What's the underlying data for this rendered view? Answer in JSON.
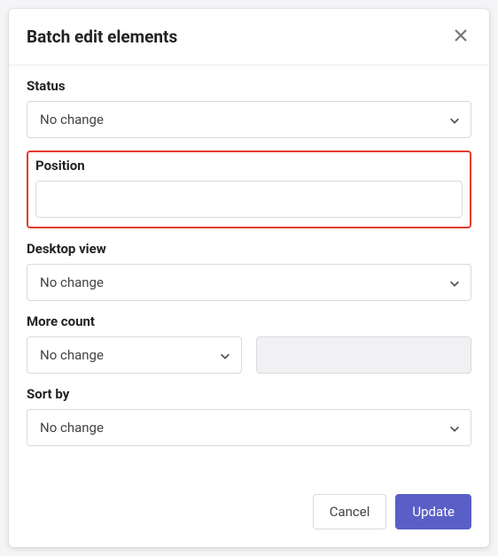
{
  "modal": {
    "title": "Batch edit elements"
  },
  "form": {
    "status": {
      "label": "Status",
      "value": "No change"
    },
    "position": {
      "label": "Position",
      "value": ""
    },
    "desktop_view": {
      "label": "Desktop view",
      "value": "No change"
    },
    "more_count": {
      "label": "More count",
      "value": "No change",
      "extra_value": ""
    },
    "sort_by": {
      "label": "Sort by",
      "value": "No change"
    }
  },
  "footer": {
    "cancel": "Cancel",
    "update": "Update"
  }
}
